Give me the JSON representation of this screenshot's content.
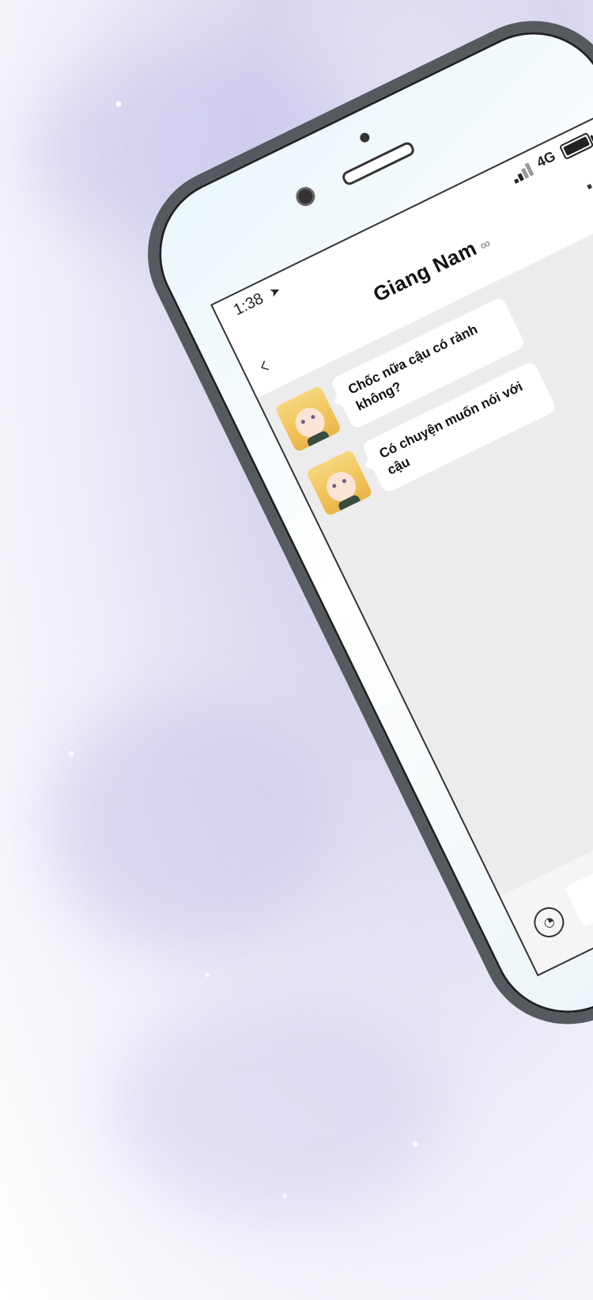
{
  "status_bar": {
    "time": "1:38",
    "network": "4G"
  },
  "chat": {
    "contact_name": "Giang Nam",
    "messages": [
      {
        "text": "Chốc nữa cậu có rảnh không?"
      },
      {
        "text": "Có chuyện muốn nói với cậu"
      }
    ]
  },
  "icons": {
    "back": "back-arrow-icon",
    "more": "more-options-icon",
    "link": "link-icon",
    "voice": "voice-icon",
    "signal": "signal-icon",
    "battery": "battery-icon",
    "location": "location-arrow-icon"
  }
}
